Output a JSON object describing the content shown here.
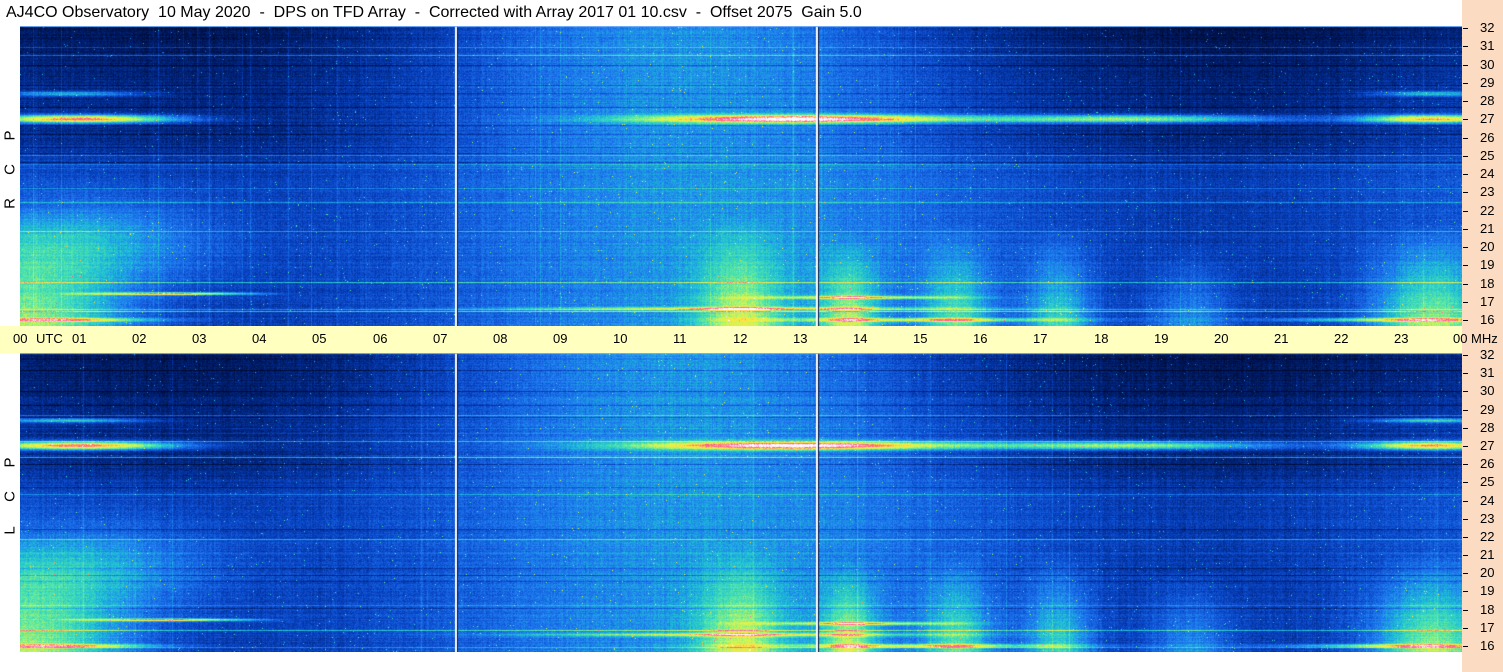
{
  "title": "AJ4CO Observatory  10 May 2020  -  DPS on TFD Array  -  Corrected with Array 2017 01 10.csv  -  Offset 2075  Gain 5.0",
  "chart_data": [
    {
      "type": "heatmap",
      "name": "RCP",
      "polarization_label": [
        "R",
        "C",
        "P"
      ],
      "x_unit": "UTC",
      "y_unit": "MHz",
      "x_ticks": [
        "00",
        "01",
        "02",
        "03",
        "04",
        "05",
        "06",
        "07",
        "08",
        "09",
        "10",
        "11",
        "12",
        "13",
        "14",
        "15",
        "16",
        "17",
        "18",
        "19",
        "20",
        "21",
        "22",
        "23",
        "00"
      ],
      "xlim": [
        0,
        24
      ],
      "y_ticks": [
        16,
        17,
        18,
        19,
        20,
        21,
        22,
        23,
        24,
        25,
        26,
        27,
        28,
        29,
        30,
        31,
        32
      ],
      "ylim": [
        16,
        32
      ],
      "time_markers_hours": [
        7.25,
        13.25
      ],
      "colormap": [
        "#000a30",
        "#00237a",
        "#0a46c8",
        "#1e78f0",
        "#1ebed7",
        "#50e6aa",
        "#c8f55a",
        "#ffeb3c",
        "#ff5096",
        "#ffffff"
      ]
    },
    {
      "type": "heatmap",
      "name": "LCP",
      "polarization_label": [
        "L",
        "C",
        "P"
      ],
      "x_unit": "UTC",
      "y_unit": "MHz",
      "x_ticks": [
        "00",
        "01",
        "02",
        "03",
        "04",
        "05",
        "06",
        "07",
        "08",
        "09",
        "10",
        "11",
        "12",
        "13",
        "14",
        "15",
        "16",
        "17",
        "18",
        "19",
        "20",
        "21",
        "22",
        "23",
        "00"
      ],
      "xlim": [
        0,
        24
      ],
      "y_ticks": [
        16,
        17,
        18,
        19,
        20,
        21,
        22,
        23,
        24,
        25,
        26,
        27,
        28,
        29,
        30,
        31,
        32
      ],
      "ylim": [
        16,
        32
      ],
      "time_markers_hours": [
        7.25,
        13.25
      ],
      "colormap": [
        "#000a30",
        "#00237a",
        "#0a46c8",
        "#1e78f0",
        "#1ebed7",
        "#50e6aa",
        "#c8f55a",
        "#ffeb3c",
        "#ff5096",
        "#ffffff"
      ]
    }
  ],
  "axis": {
    "x_unit_label": "UTC",
    "y_unit_label": "MHz"
  }
}
